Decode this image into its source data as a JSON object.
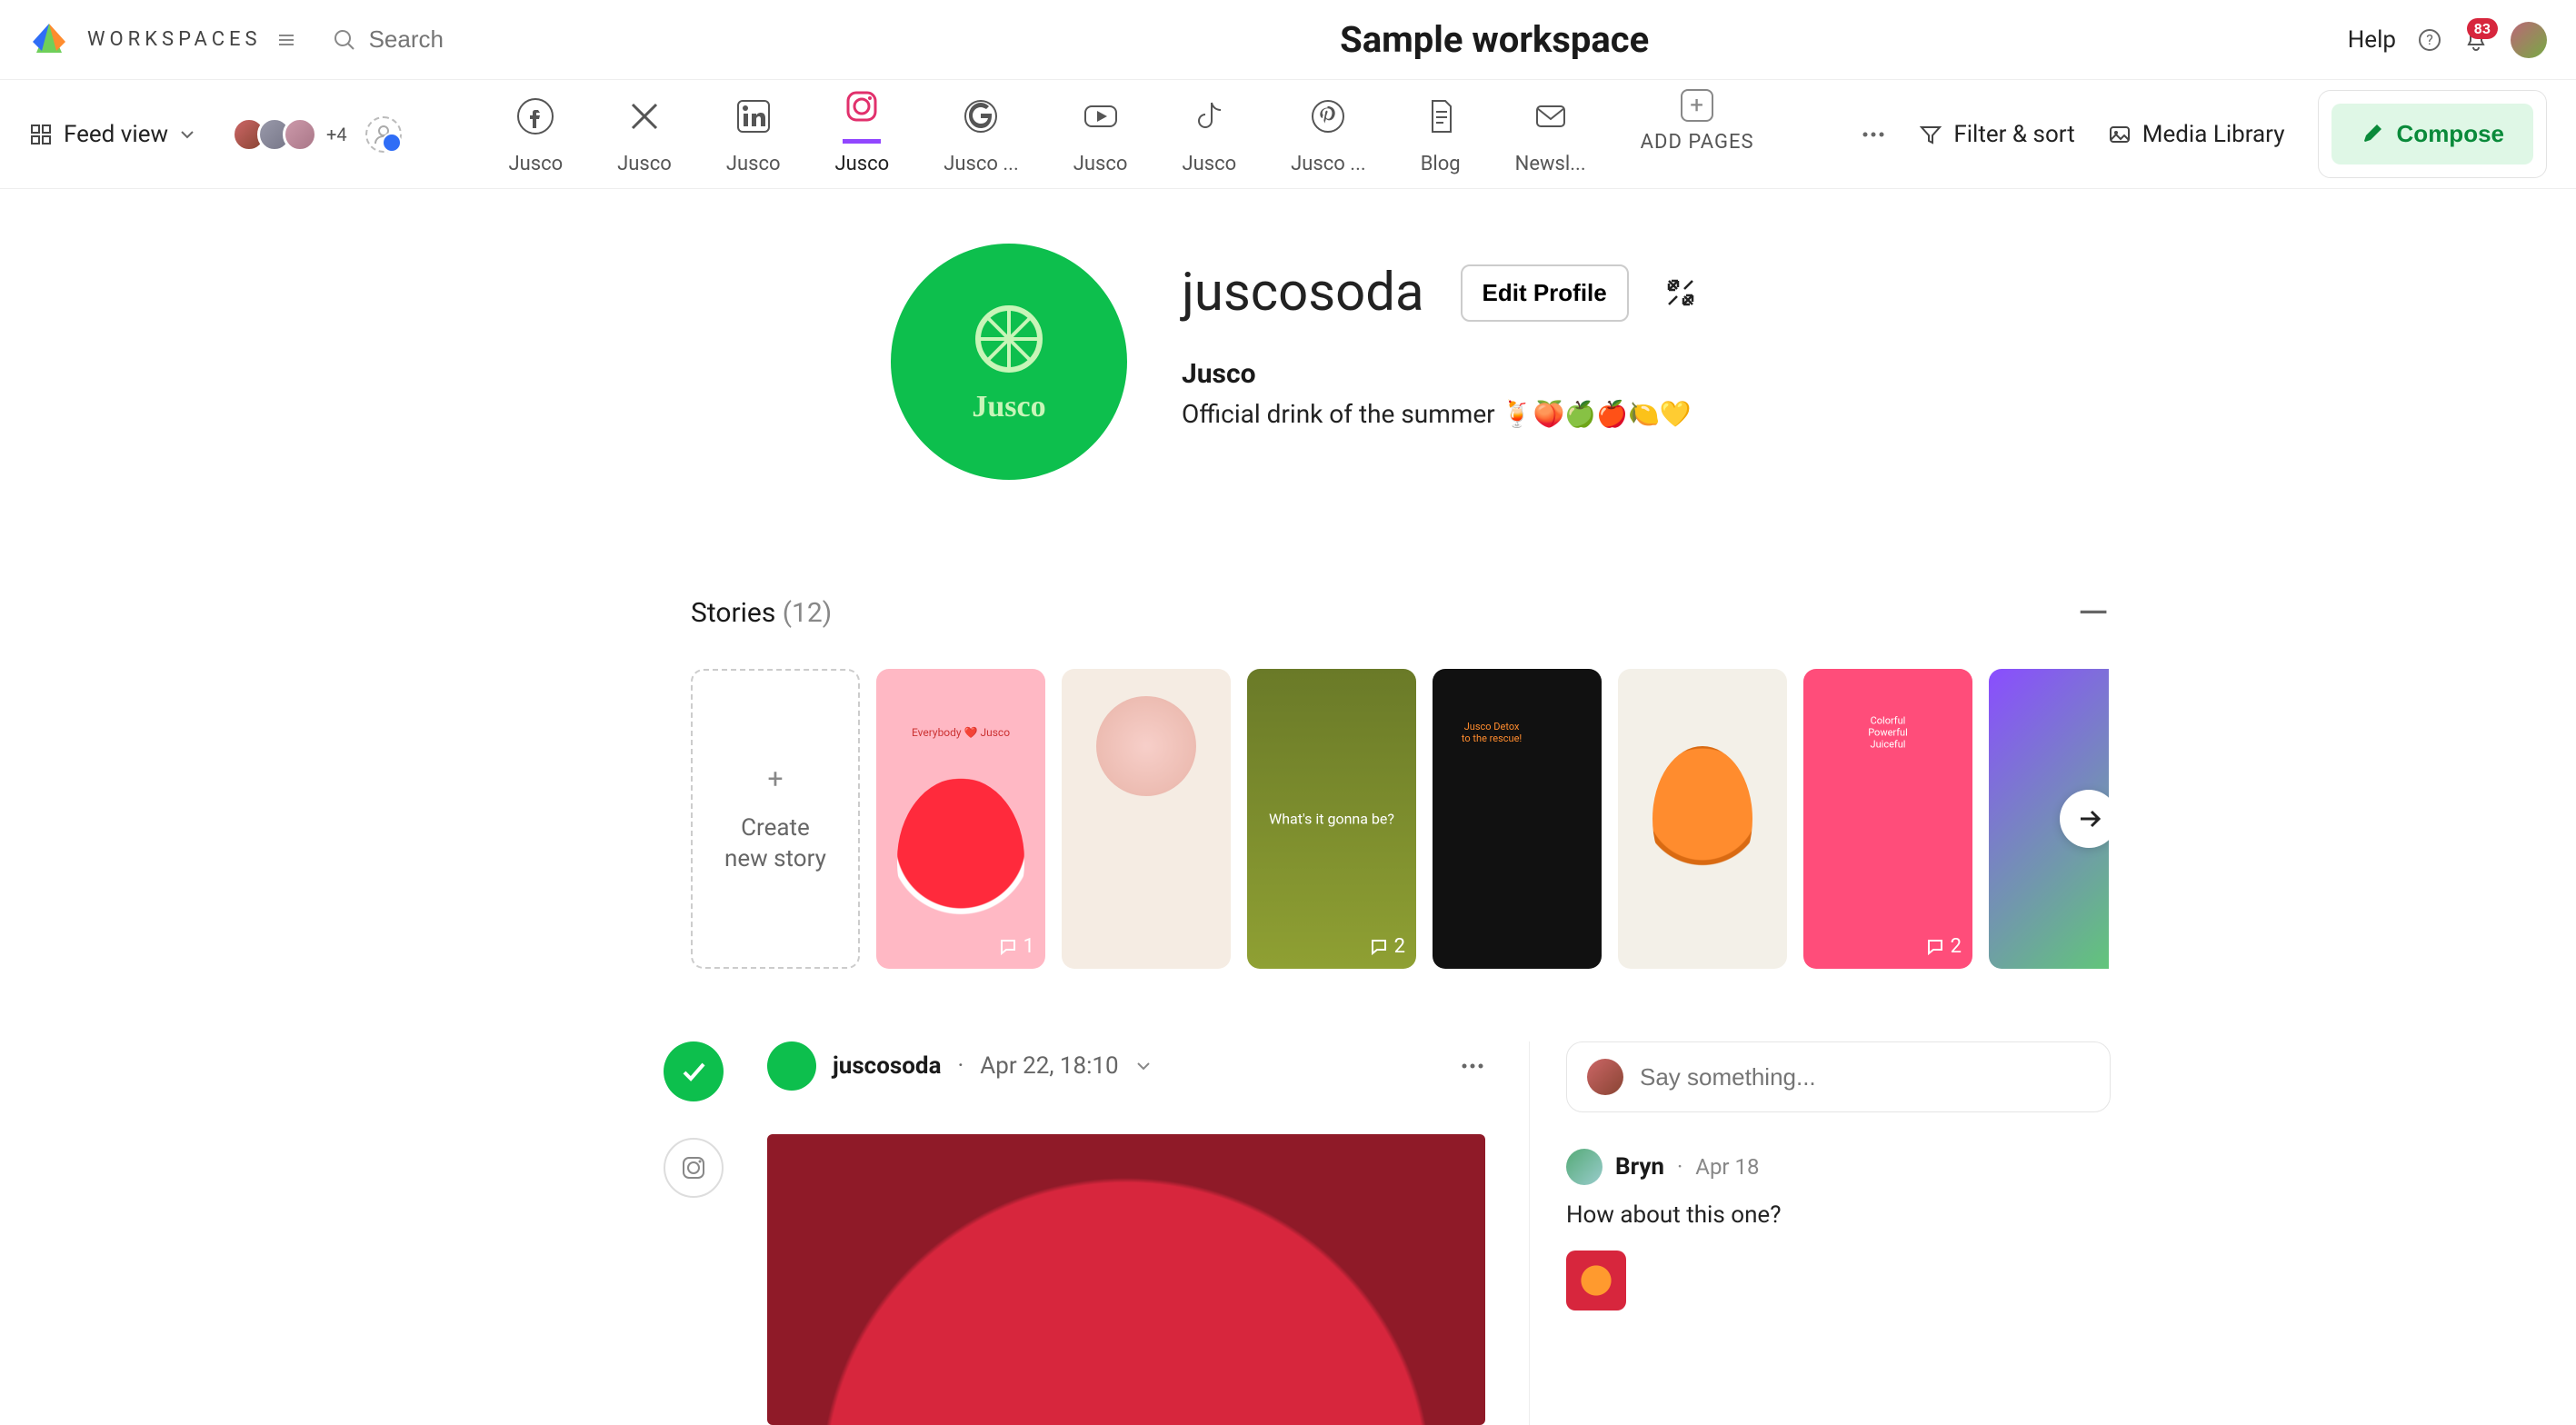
{
  "topbar": {
    "workspaces_label": "WORKSPACES",
    "search_placeholder": "Search",
    "title": "Sample workspace",
    "help_label": "Help",
    "notification_count": "83"
  },
  "secondbar": {
    "feed_view_label": "Feed view",
    "avatar_overflow": "+4",
    "channels": [
      {
        "label": "Jusco"
      },
      {
        "label": "Jusco"
      },
      {
        "label": "Jusco"
      },
      {
        "label": "Jusco"
      },
      {
        "label": "Jusco ..."
      },
      {
        "label": "Jusco"
      },
      {
        "label": "Jusco"
      },
      {
        "label": "Jusco ..."
      },
      {
        "label": "Blog"
      },
      {
        "label": "Newsl..."
      }
    ],
    "add_pages_label": "ADD PAGES",
    "filter_sort_label": "Filter & sort",
    "media_library_label": "Media Library",
    "compose_label": "Compose"
  },
  "profile": {
    "handle": "juscosoda",
    "edit_label": "Edit Profile",
    "name": "Jusco",
    "bio": "Official drink of the summer 🍹🍑🍏🍎🍋💛"
  },
  "stories": {
    "title": "Stories",
    "count": "(12)",
    "create_label": "Create\nnew story",
    "items": [
      {
        "caption_top": "Everybody ❤️ Jusco",
        "badge": "1"
      },
      {},
      {
        "caption": "What's it gonna be?",
        "badge": "2"
      },
      {
        "caption_top": "Jusco Detox\nto the rescue!"
      },
      {},
      {
        "caption_top": "Colorful\nPowerful\nJuiceful",
        "badge": "2"
      },
      {}
    ]
  },
  "post": {
    "handle": "juscosoda",
    "time_sep": "·",
    "time": "Apr 22, 18:10"
  },
  "comments": {
    "input_placeholder": "Say something...",
    "items": [
      {
        "author": "Bryn",
        "sep": "·",
        "date": "Apr 18",
        "body": "How about this one?"
      }
    ]
  }
}
